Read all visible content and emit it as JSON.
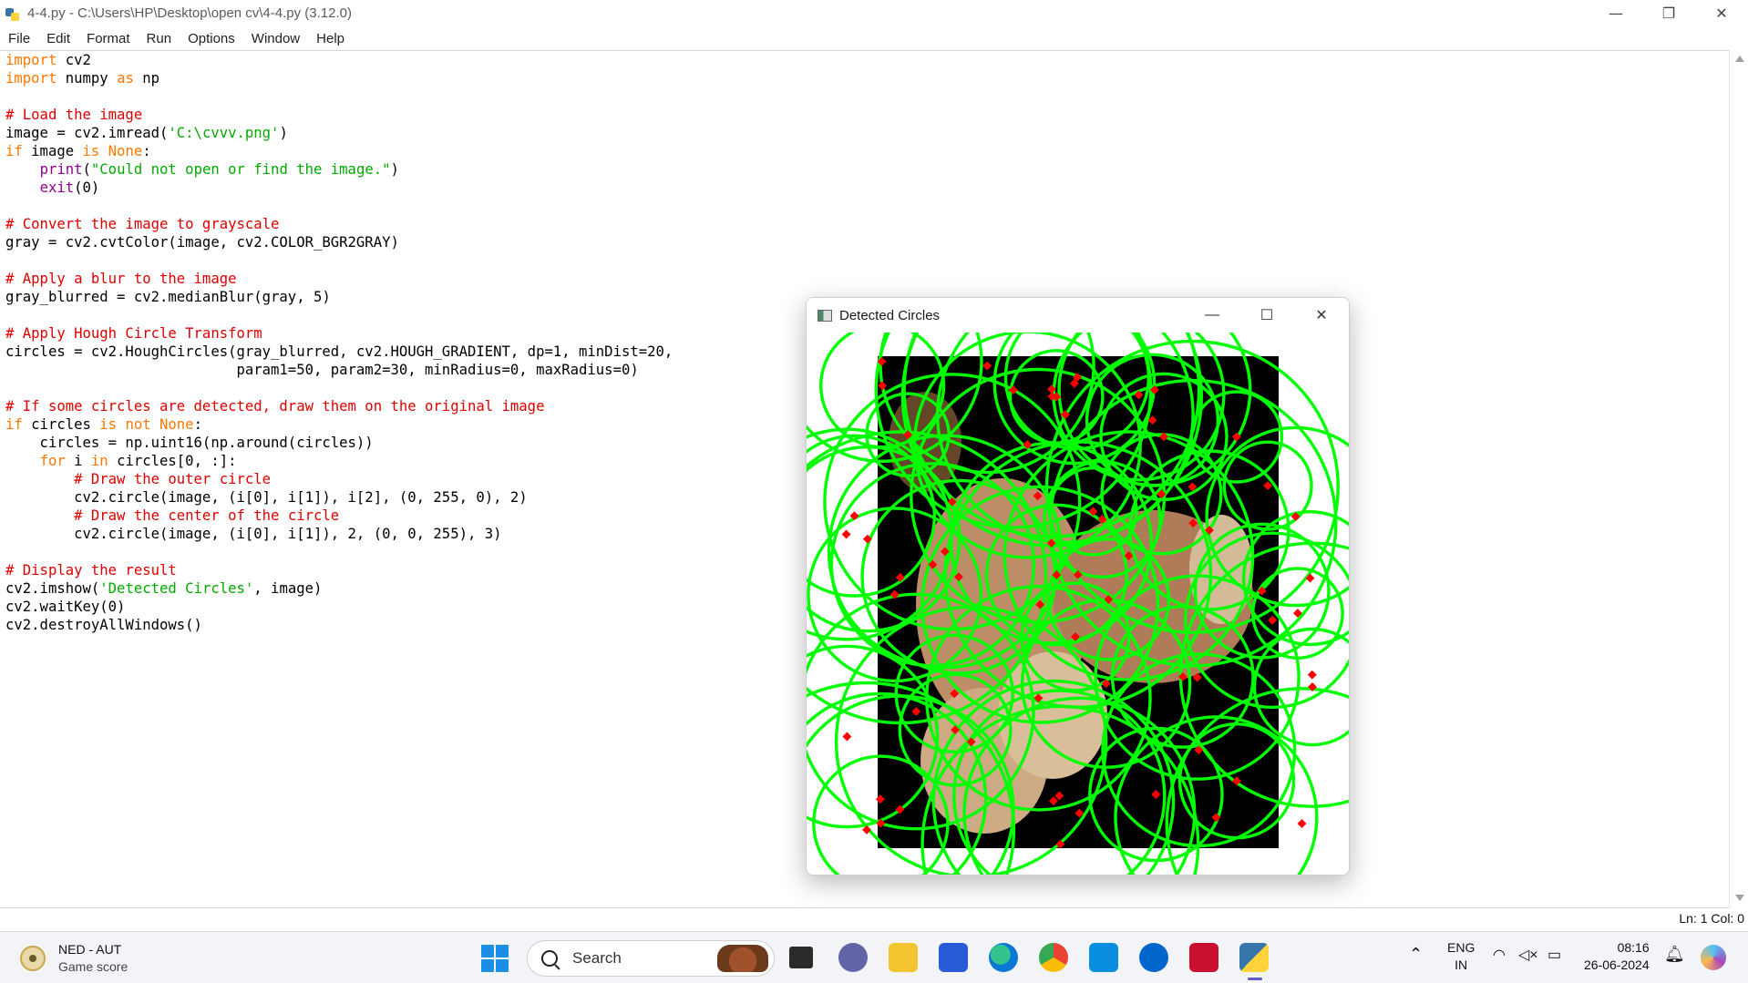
{
  "window": {
    "title": "4-4.py - C:\\Users\\HP\\Desktop\\open cv\\4-4.py (3.12.0)",
    "controls": [
      "—",
      "❐",
      "✕"
    ]
  },
  "menu": [
    "File",
    "Edit",
    "Format",
    "Run",
    "Options",
    "Window",
    "Help"
  ],
  "code_lines": [
    [
      {
        "t": "import",
        "c": "kw"
      },
      {
        "t": " cv2"
      }
    ],
    [
      {
        "t": "import",
        "c": "kw"
      },
      {
        "t": " numpy "
      },
      {
        "t": "as",
        "c": "kw"
      },
      {
        "t": " np"
      }
    ],
    [],
    [
      {
        "t": "# Load the image",
        "c": "cm"
      }
    ],
    [
      {
        "t": "image = cv2.imread("
      },
      {
        "t": "'C:\\cvvv.png'",
        "c": "st"
      },
      {
        "t": ")"
      }
    ],
    [
      {
        "t": "if",
        "c": "kw"
      },
      {
        "t": " image "
      },
      {
        "t": "is",
        "c": "kw"
      },
      {
        "t": " "
      },
      {
        "t": "None",
        "c": "kw"
      },
      {
        "t": ":"
      }
    ],
    [
      {
        "t": "    "
      },
      {
        "t": "print",
        "c": "bi"
      },
      {
        "t": "("
      },
      {
        "t": "\"Could not open or find the image.\"",
        "c": "st"
      },
      {
        "t": ")"
      }
    ],
    [
      {
        "t": "    "
      },
      {
        "t": "exit",
        "c": "bi"
      },
      {
        "t": "(0)"
      }
    ],
    [],
    [
      {
        "t": "# Convert the image to grayscale",
        "c": "cm"
      }
    ],
    [
      {
        "t": "gray = cv2.cvtColor(image, cv2.COLOR_BGR2GRAY)"
      }
    ],
    [],
    [
      {
        "t": "# Apply a blur to the image",
        "c": "cm"
      }
    ],
    [
      {
        "t": "gray_blurred = cv2.medianBlur(gray, 5)"
      }
    ],
    [],
    [
      {
        "t": "# Apply Hough Circle Transform",
        "c": "cm"
      }
    ],
    [
      {
        "t": "circles = cv2.HoughCircles(gray_blurred, cv2.HOUGH_GRADIENT, dp=1, minDist=20,"
      }
    ],
    [
      {
        "t": "                           param1=50, param2=30, minRadius=0, maxRadius=0)"
      }
    ],
    [],
    [
      {
        "t": "# If some circles are detected, draw them on the original image",
        "c": "cm"
      }
    ],
    [
      {
        "t": "if",
        "c": "kw"
      },
      {
        "t": " circles "
      },
      {
        "t": "is not None",
        "c": "kw"
      },
      {
        "t": ":"
      }
    ],
    [
      {
        "t": "    circles = np.uint16(np.around(circles))"
      }
    ],
    [
      {
        "t": "    "
      },
      {
        "t": "for",
        "c": "kw"
      },
      {
        "t": " i "
      },
      {
        "t": "in",
        "c": "kw"
      },
      {
        "t": " circles[0, :]:"
      }
    ],
    [
      {
        "t": "        "
      },
      {
        "t": "# Draw the outer circle",
        "c": "cm"
      }
    ],
    [
      {
        "t": "        cv2.circle(image, (i[0], i[1]), i[2], (0, 255, 0), 2)"
      }
    ],
    [
      {
        "t": "        "
      },
      {
        "t": "# Draw the center of the circle",
        "c": "cm"
      }
    ],
    [
      {
        "t": "        cv2.circle(image, (i[0], i[1]), 2, (0, 0, 255), 3)"
      }
    ],
    [],
    [
      {
        "t": "# Display the result",
        "c": "cm"
      }
    ],
    [
      {
        "t": "cv2.imshow("
      },
      {
        "t": "'Detected Circles'",
        "c": "st"
      },
      {
        "t": ", image)"
      }
    ],
    [
      {
        "t": "cv2.waitKey(0)"
      }
    ],
    [
      {
        "t": "cv2.destroyAllWindows()"
      }
    ]
  ],
  "status": "Ln: 1   Col: 0",
  "cv_window": {
    "title": "Detected Circles",
    "controls": [
      "—",
      "☐",
      "✕"
    ]
  },
  "taskbar": {
    "widget_title": "NED - AUT",
    "widget_sub": "Game score",
    "search_label": "Search",
    "lang_top": "ENG",
    "lang_bottom": "IN",
    "time": "08:16",
    "date": "26-06-2024"
  },
  "colors": {
    "keyword": "#ff7700",
    "comment": "#dd0000",
    "string": "#00aa00",
    "builtin": "#900090",
    "circle": "#00ff00",
    "center": "#ff0000"
  }
}
